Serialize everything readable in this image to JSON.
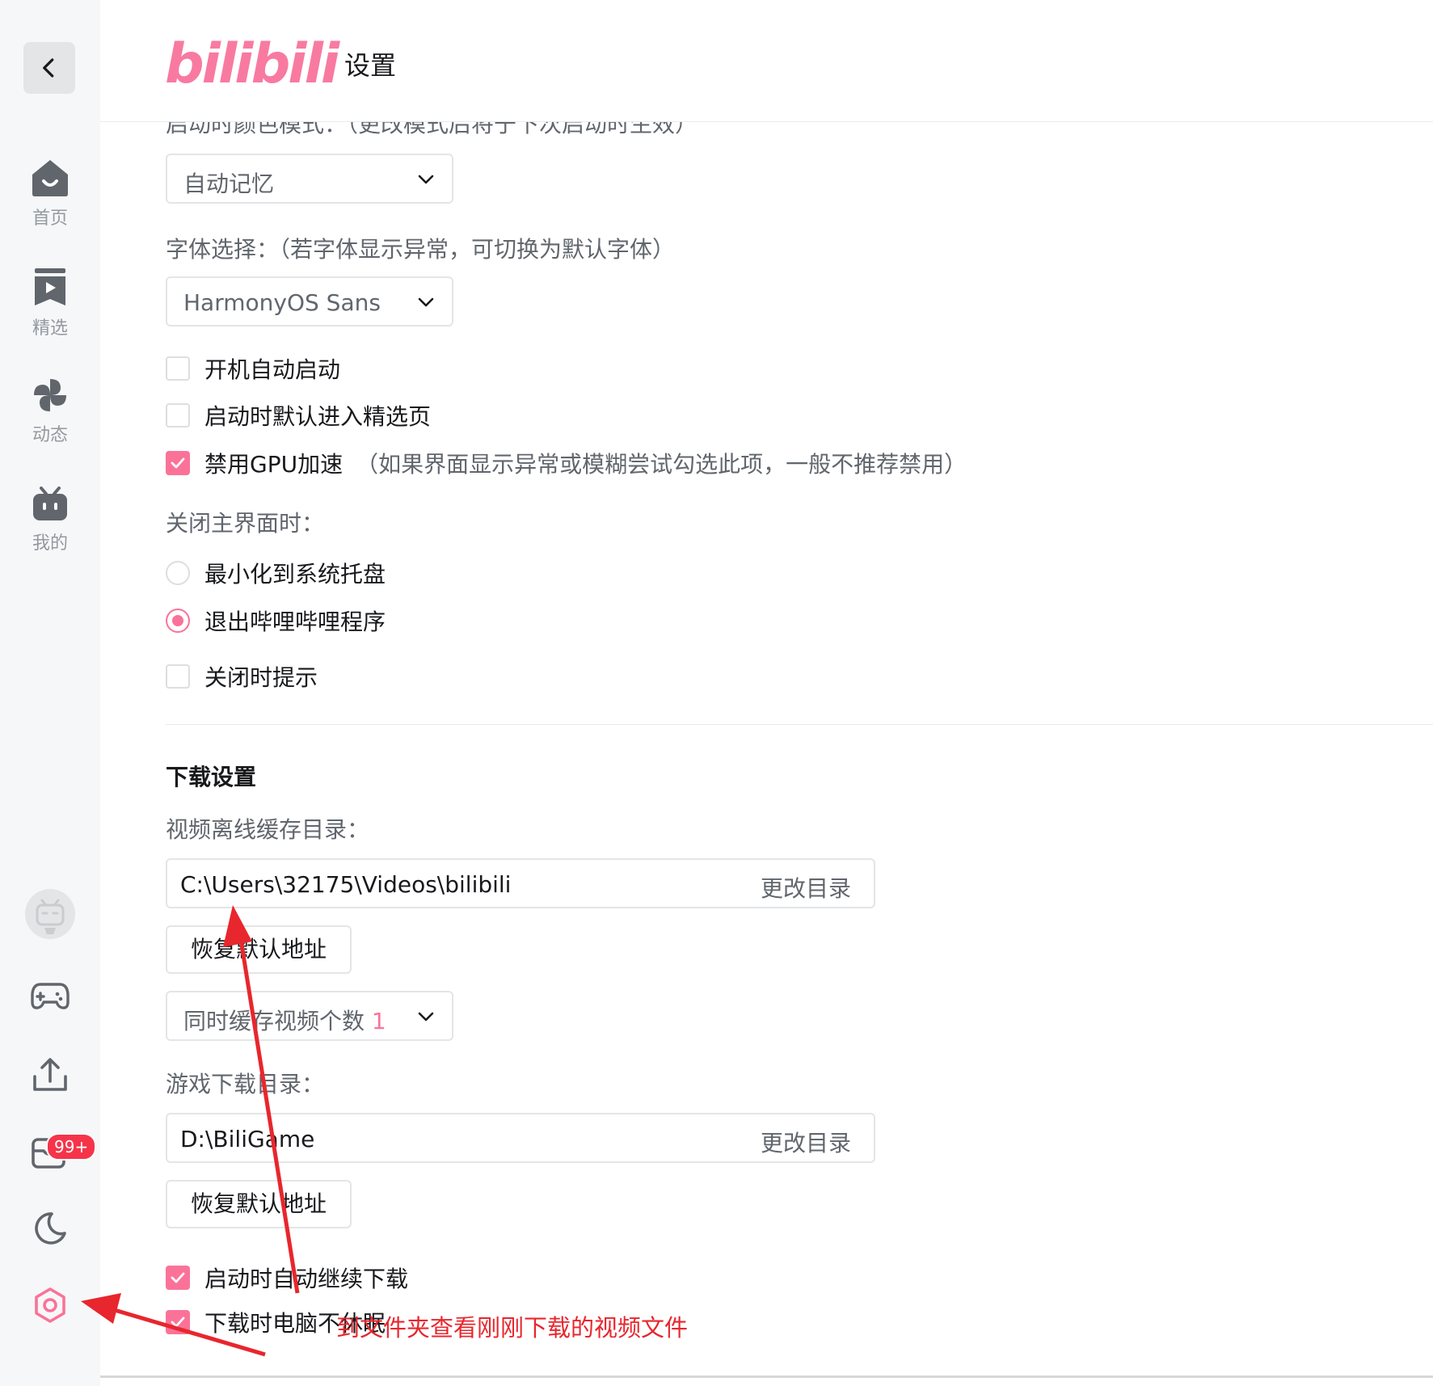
{
  "header": {
    "logo": "bilibili",
    "title": "设置"
  },
  "sidebar": {
    "items": [
      {
        "label": "首页",
        "icon": "home-icon"
      },
      {
        "label": "精选",
        "icon": "featured-icon"
      },
      {
        "label": "动态",
        "icon": "pinwheel-icon"
      },
      {
        "label": "我的",
        "icon": "tv-icon"
      }
    ],
    "badge": "99+"
  },
  "general": {
    "color_mode_label": "启动时颜色模式：（更改模式后将于下次启动时生效）",
    "color_mode_value": "自动记忆",
    "font_label": "字体选择：（若字体显示异常，可切换为默认字体）",
    "font_value": "HarmonyOS Sans",
    "auto_start": "开机自动启动",
    "open_featured": "启动时默认进入精选页",
    "disable_gpu": "禁用GPU加速",
    "disable_gpu_note": "（如果界面显示异常或模糊尝试勾选此项，一般不推荐禁用）",
    "close_label": "关闭主界面时：",
    "minimize_tray": "最小化到系统托盘",
    "exit_program": "退出哔哩哔哩程序",
    "close_prompt": "关闭时提示"
  },
  "download": {
    "section_title": "下载设置",
    "video_dir_label": "视频离线缓存目录：",
    "video_dir": "C:\\Users\\32175\\Videos\\bilibili",
    "change_dir": "更改目录",
    "restore_default": "恢复默认地址",
    "concurrent_label": "同时缓存视频个数",
    "concurrent_value": "1",
    "game_dir_label": "游戏下载目录：",
    "game_dir": "D:\\BiliGame",
    "auto_resume": "启动时自动继续下载",
    "no_sleep": "下载时电脑不休眠"
  },
  "annotation": {
    "text": "到文件夹查看刚刚下载的视频文件"
  },
  "colors": {
    "accent": "#fb7299",
    "annotation": "#e8262d"
  }
}
